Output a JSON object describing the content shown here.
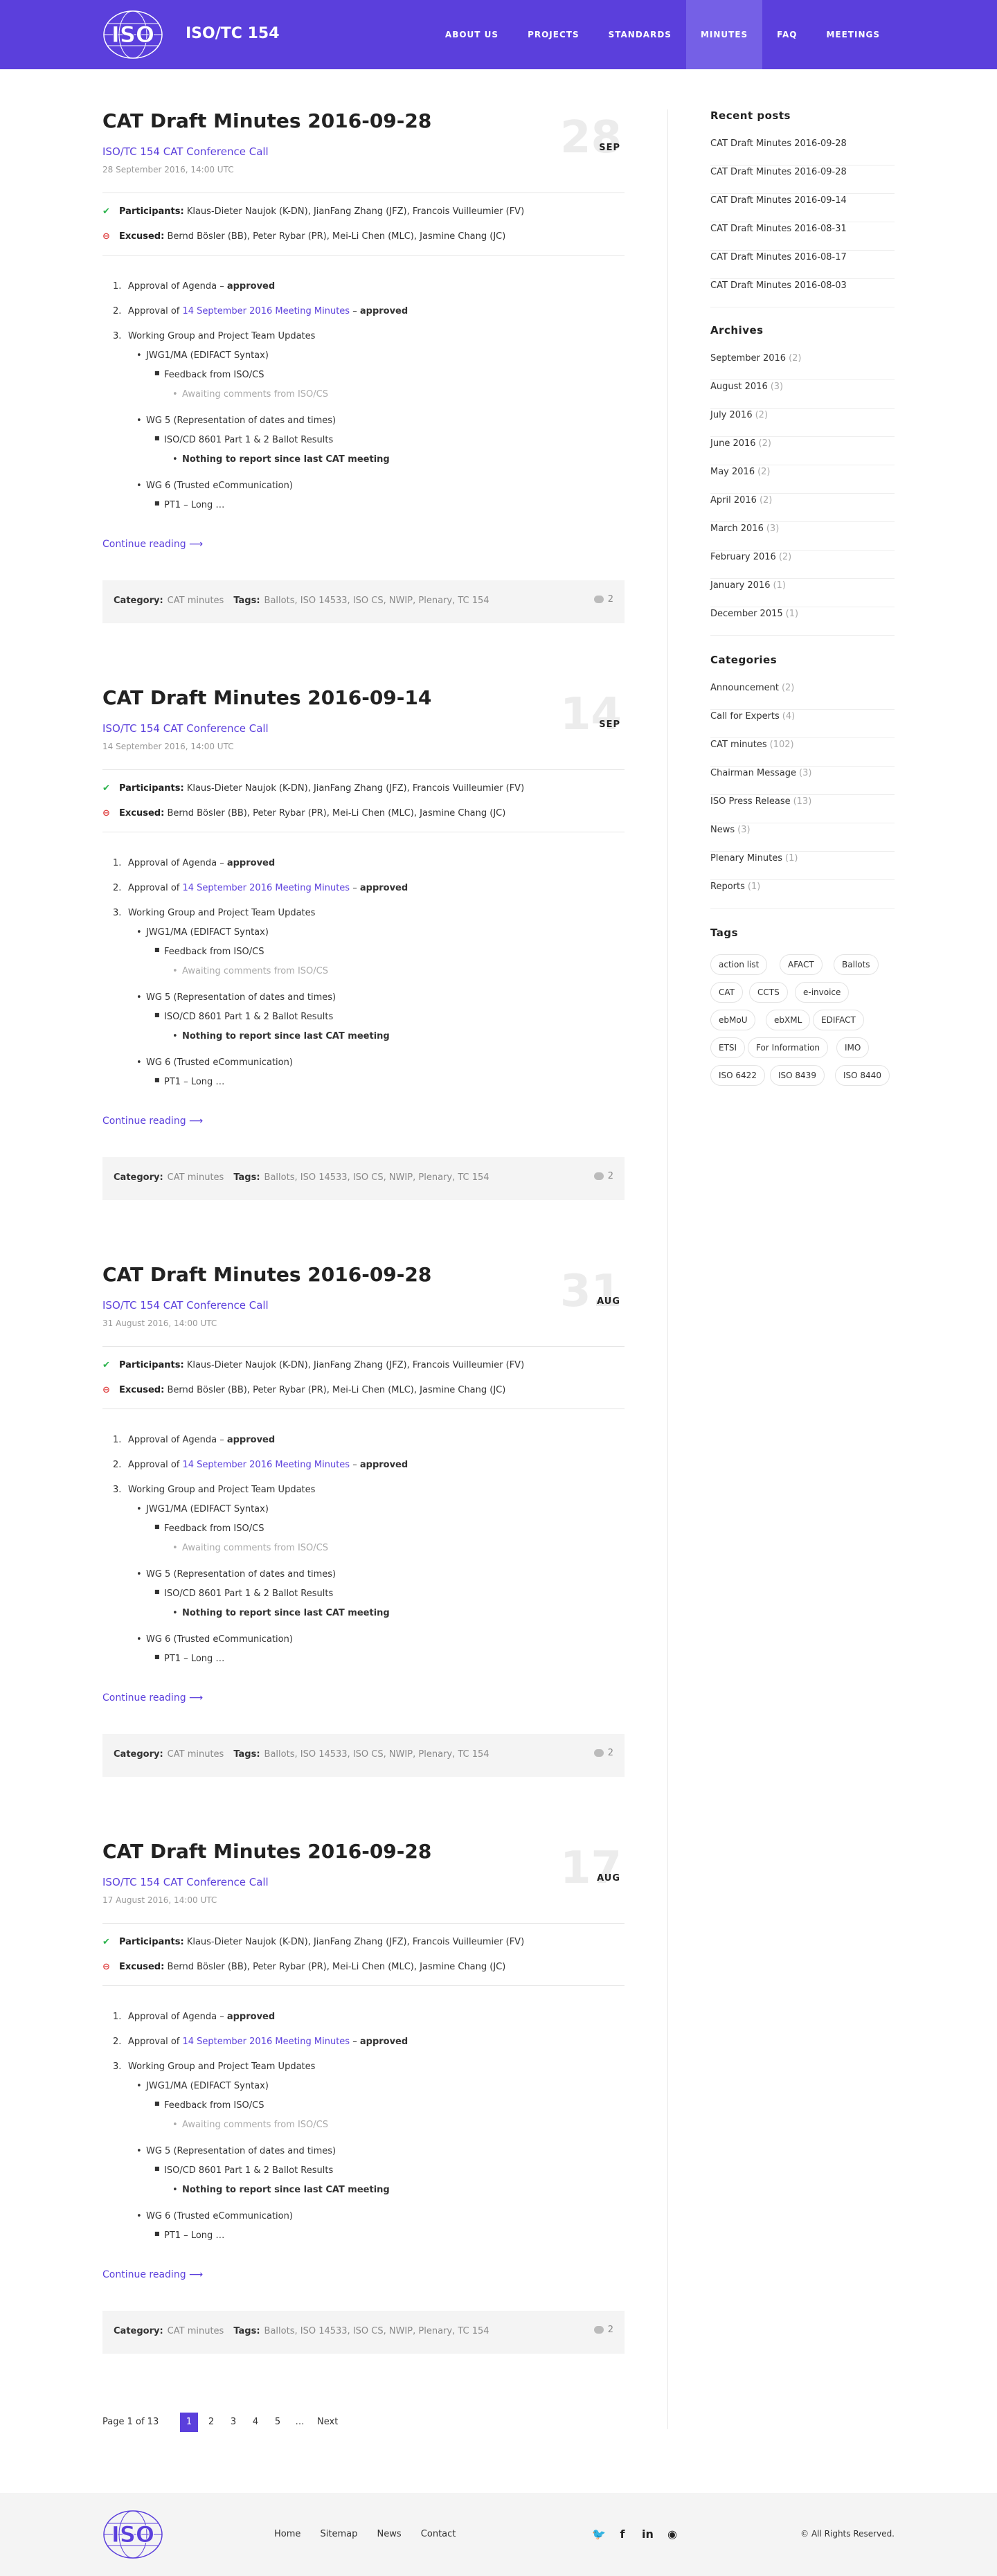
{
  "header": {
    "logo_text": "ISO",
    "site_title": "ISO/TC 154",
    "nav": [
      {
        "label": "About us"
      },
      {
        "label": "Projects"
      },
      {
        "label": "Standards"
      },
      {
        "label": "Minutes"
      },
      {
        "label": "FAQ"
      },
      {
        "label": "Meetings"
      }
    ],
    "active_nav": "Minutes"
  },
  "posts": [
    {
      "title": "CAT Draft Minutes 2016-09-28",
      "subtitle": "ISO/TC 154 CAT Conference Call",
      "date": "28 September 2016, 14:00 UTC",
      "day": "28",
      "month": "SEP"
    },
    {
      "title": "CAT Draft Minutes 2016-09-14",
      "subtitle": "ISO/TC 154 CAT Conference Call",
      "date": "14 September 2016, 14:00 UTC",
      "day": "14",
      "month": "SEP"
    },
    {
      "title": "CAT Draft Minutes 2016-09-28",
      "subtitle": "ISO/TC 154 CAT Conference Call",
      "date": "31 August 2016, 14:00 UTC",
      "day": "31",
      "month": "AUG"
    },
    {
      "title": "CAT Draft Minutes 2016-09-28",
      "subtitle": "ISO/TC 154 CAT Conference Call",
      "date": "17 August 2016, 14:00 UTC",
      "day": "17",
      "month": "AUG"
    }
  ],
  "common": {
    "participants_label": "Participants:",
    "participants": "Klaus-Dieter Naujok (K-DN), JianFang Zhang (JFZ), Francois Vuilleumier (FV)",
    "excused_label": "Excused:",
    "excused": "Bernd Bösler (BB), Peter Rybar (PR), Mei-Li Chen (MLC), Jasmine Chang (JC)",
    "items": {
      "agenda": "Approval of Agenda – ",
      "approved": "approved",
      "approval_of": "Approval of ",
      "meeting_link": "14 September 2016 Meeting Minutes",
      "dash": " – ",
      "wg_updates": "Working Group and Project Team Updates",
      "jwg1": "JWG1/MA (EDIFACT Syntax)",
      "feedback": "Feedback from ISO/CS",
      "awaiting": "Awaiting comments from ISO/CS",
      "wg5": "WG 5 (Representation of dates and times)",
      "iso8601": "ISO/CD 8601 Part 1 & 2 Ballot Results",
      "nothing": "Nothing to report since last CAT meeting",
      "wg6": "WG 6 (Trusted eCommunication)",
      "pt1": "PT1 – Long …"
    },
    "continue": "Continue reading",
    "category_label": "Category:",
    "category": "CAT minutes",
    "tags_label": "Tags:",
    "tags": "Ballots, ISO 14533, ISO CS, NWIP, Plenary, TC 154",
    "comments": "2"
  },
  "pagination": {
    "info": "Page 1 of 13",
    "pages": [
      "1",
      "2",
      "3",
      "4",
      "5",
      "…"
    ],
    "next": "Next"
  },
  "sidebar": {
    "recent_title": "Recent posts",
    "recent": [
      "CAT Draft Minutes 2016-09-28",
      "CAT Draft Minutes 2016-09-28",
      "CAT Draft Minutes 2016-09-14",
      "CAT Draft Minutes 2016-08-31",
      "CAT Draft Minutes 2016-08-17",
      "CAT Draft Minutes 2016-08-03"
    ],
    "archives_title": "Archives",
    "archives": [
      {
        "label": "September 2016",
        "count": "(2)"
      },
      {
        "label": "August 2016",
        "count": "(3)"
      },
      {
        "label": "July 2016",
        "count": "(2)"
      },
      {
        "label": "June 2016",
        "count": "(2)"
      },
      {
        "label": "May 2016",
        "count": "(2)"
      },
      {
        "label": "April 2016",
        "count": "(2)"
      },
      {
        "label": "March 2016",
        "count": "(3)"
      },
      {
        "label": "February 2016",
        "count": "(2)"
      },
      {
        "label": "January 2016",
        "count": "(1)"
      },
      {
        "label": "December 2015",
        "count": "(1)"
      }
    ],
    "categories_title": "Categories",
    "categories": [
      {
        "label": "Announcement",
        "count": "(2)"
      },
      {
        "label": "Call for Experts",
        "count": "(4)"
      },
      {
        "label": "CAT minutes",
        "count": "(102)"
      },
      {
        "label": "Chairman Message",
        "count": "(3)"
      },
      {
        "label": "ISO Press Release",
        "count": "(13)"
      },
      {
        "label": "News",
        "count": "(3)"
      },
      {
        "label": "Plenary Minutes",
        "count": "(1)"
      },
      {
        "label": "Reports",
        "count": "(1)"
      }
    ],
    "tags_title": "Tags",
    "tags": [
      "action list",
      "AFACT",
      "Ballots",
      "CAT",
      "CCTS",
      "e-invoice",
      "ebMoU",
      "ebXML",
      "EDIFACT",
      "ETSI",
      "For Information",
      "IMO",
      "ISO 6422",
      "ISO 8439",
      "ISO 8440"
    ]
  },
  "footer": {
    "logo_text": "ISO",
    "links": [
      "Home",
      "Sitemap",
      "News",
      "Contact"
    ],
    "social": [
      "twitter-icon",
      "facebook-icon",
      "linkedin-icon",
      "github-icon"
    ],
    "copyright": "© All Rights Reserved."
  },
  "colors": {
    "brand": "#5b3fdc",
    "nav_active": "#7560e6",
    "participants_check": "#2bb34c",
    "excused_minus": "#e04444"
  }
}
